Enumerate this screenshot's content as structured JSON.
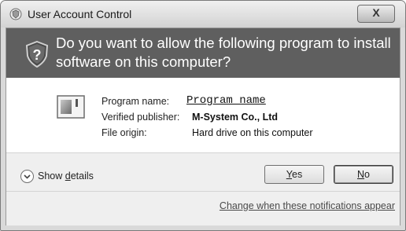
{
  "window": {
    "title": "User Account Control",
    "close_glyph": "X"
  },
  "banner": {
    "question": "Do you want to allow the following program to install software on this computer?",
    "icon": "shield-question-icon"
  },
  "program": {
    "icon": "program-icon",
    "rows": [
      {
        "label": "Program name:",
        "value": "Program name"
      },
      {
        "label": "Verified publisher:",
        "value": "M-System Co., Ltd"
      },
      {
        "label": "File origin:",
        "value": "Hard drive on this computer"
      }
    ]
  },
  "footer": {
    "show_details_label_prefix": "Show ",
    "show_details_label_accel": "d",
    "show_details_label_suffix": "etails",
    "yes_accel": "Y",
    "yes_rest": "es",
    "no_accel": "N",
    "no_rest": "o",
    "change_link": "Change when these notifications appear"
  }
}
